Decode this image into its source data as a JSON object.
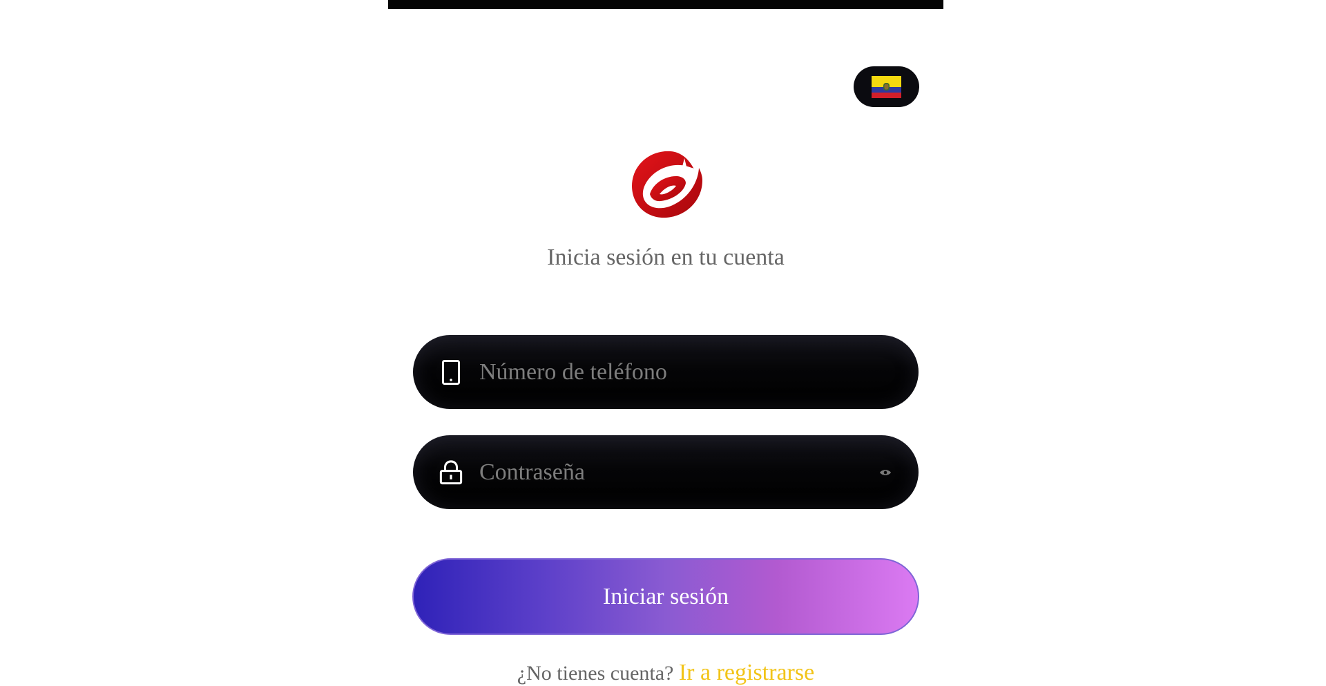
{
  "header": {
    "language": {
      "flag_icon": "ecuador-flag-icon",
      "flag_colors": {
        "yellow": "#f5d90f",
        "blue": "#2f3a9e",
        "red": "#d21f2a"
      }
    }
  },
  "brand": {
    "logo_icon": "red-swirl-logo-icon",
    "logo_color": "#d10f14"
  },
  "login": {
    "subtitle": "Inicia sesión en tu cuenta",
    "phone": {
      "icon": "phone-icon",
      "placeholder": "Número de teléfono",
      "value": ""
    },
    "password": {
      "icon": "lock-icon",
      "placeholder": "Contraseña",
      "value": "",
      "toggle_icon": "eye-icon"
    },
    "submit_label": "Iniciar sesión",
    "no_account_text": "¿No tienes cuenta?",
    "register_link": "Ir a registrarse",
    "accent_color": "#f2c418"
  }
}
